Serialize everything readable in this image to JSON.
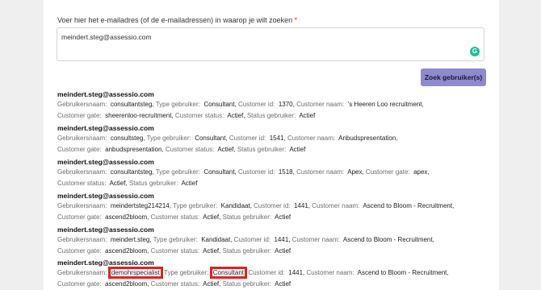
{
  "form": {
    "label": "Voer hier het e-mailadres (of de e-mailadressen) in waarop je wilt zoeken",
    "required_mark": "*",
    "email_value": "meindert.steg@assessio.com",
    "grammarly_icon": "G",
    "search_button": "Zoek gebruiker(s)"
  },
  "labels": {
    "username": "Gebruikersnaam:",
    "user_type": "Type gebruiker:",
    "customer_id": "Customer id:",
    "customer_name": "Customer naam:",
    "customer_gate": "Customer gate:",
    "customer_status": "Customer status:",
    "user_status": "Status gebruiker:"
  },
  "results": [
    {
      "email": "meindert.steg@assessio.com",
      "username": "consultantsteg",
      "user_type": "Consultant",
      "customer_id": "1370",
      "customer_name": "'s Heeren Loo recruitment",
      "customer_gate": "sheerenloo-recruitment",
      "customer_status": "Actief",
      "user_status": "Actief"
    },
    {
      "email": "meindert.steg@assessio.com",
      "username": "consultsteg",
      "user_type": "Consultant",
      "customer_id": "1541",
      "customer_name": "Anbudspresentation",
      "customer_gate": "anbudspresentation",
      "customer_status": "Actief",
      "user_status": "Actief"
    },
    {
      "email": "meindert.steg@assessio.com",
      "username": "consultantsteg",
      "user_type": "Consultant",
      "customer_id": "1518",
      "customer_name": "Apex",
      "customer_gate": "apex",
      "customer_status": "Actief",
      "user_status": "Actief"
    },
    {
      "email": "meindert.steg@assessio.com",
      "username": "meindertsteg214214",
      "user_type": "Kandidaat",
      "customer_id": "1441",
      "customer_name": "Ascend to Bloom - Recruitment",
      "customer_gate": "ascend2bloom",
      "customer_status": "Actief",
      "user_status": "Actief"
    },
    {
      "email": "meindert.steg@assessio.com",
      "username": "meindert.steg",
      "user_type": "Kandidaat",
      "customer_id": "1441",
      "customer_name": "Ascend to Bloom - Recruitment",
      "customer_gate": "ascend2bloom",
      "customer_status": "Actief",
      "user_status": "Actief"
    },
    {
      "email": "meindert.steg@assessio.com",
      "username": "demohrspecialist",
      "user_type": "Consultant",
      "customer_id": "1441",
      "customer_name": "Ascend to Bloom - Recruitment",
      "customer_gate": "ascend2bloom",
      "customer_status": "Actief",
      "user_status": "Actief"
    }
  ],
  "colors": {
    "accent_button": "#8f89d0",
    "highlight": "#e3211d",
    "required": "#d9232d"
  }
}
